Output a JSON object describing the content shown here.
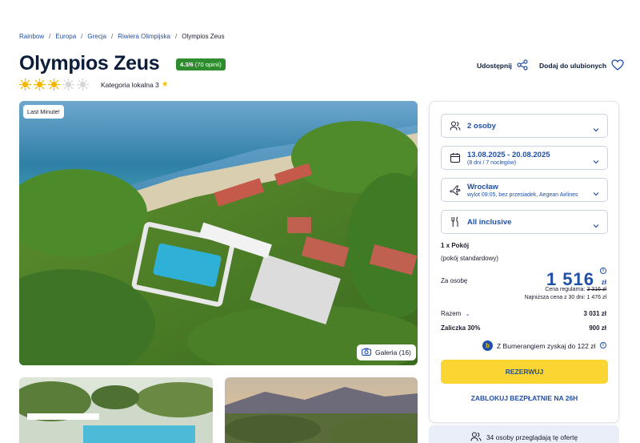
{
  "breadcrumb": [
    "Rainbow",
    "Europa",
    "Grecja",
    "Riwiera Olimpijska",
    "Olympios Zeus"
  ],
  "hotel": {
    "name": "Olympios Zeus",
    "rating": "4.3/6",
    "rating_count": "(70 opinii)",
    "suns_filled": 3,
    "suns_total": 5,
    "category": "Kategoria lokalna 3"
  },
  "actions": {
    "share": "Udostępnij",
    "favorite": "Dodaj do ulubionych"
  },
  "hero": {
    "badge": "Last Minute!",
    "gallery": "Galeria (16)"
  },
  "booking": {
    "persons": "2 osoby",
    "dates": "13.08.2025 - 20.08.2025",
    "dates_sub": "(8 dni / 7 noclegów)",
    "departure": "Wrocław",
    "departure_sub": "wylot 09:05, bez przesiadek, Aegean Airlines",
    "board": "All inclusive",
    "room": "1 x Pokój",
    "room_type": "(pokój standardowy)",
    "per_person_label": "Za osobę",
    "price": "1 516",
    "currency": "zł",
    "regular_label": "Cena regularna:",
    "regular_price": "3 316 zł",
    "lowest_label": "Najniższa cena z 30 dni: 1 476 zł",
    "total_label": "Razem",
    "total_value": "3 031 zł",
    "deposit_label": "Zaliczka 30%",
    "deposit_value": "900 zł",
    "bumerang": "Z Bumerangiem zyskaj do 122 zł",
    "reserve": "REZERWUJ",
    "block": "ZABLOKUJ BEZPŁATNIE NA 26H"
  },
  "viewers": "34 osoby przeglądają tę ofertę",
  "colors": {
    "brand_blue": "#1f4fa8",
    "cta_yellow": "#fbd531",
    "rating_green": "#2e8b2e"
  }
}
